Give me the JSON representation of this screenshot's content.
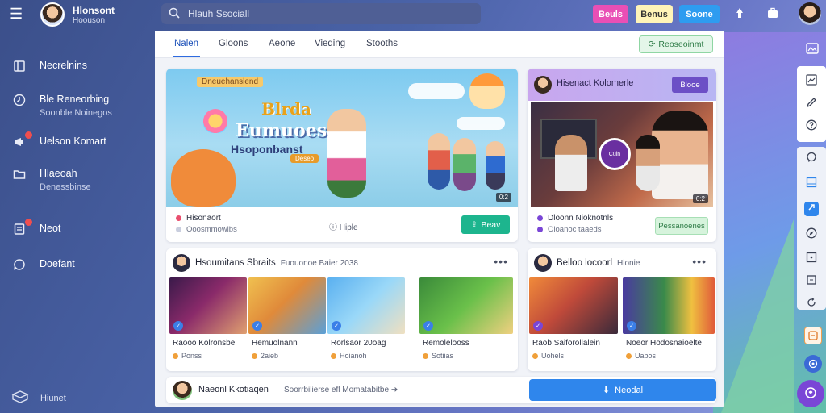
{
  "app": {
    "brand_title": "Hlonsont",
    "brand_subtitle": "Hoouson",
    "search_placeholder": "Hlauh Ssociall"
  },
  "top_buttons": [
    {
      "label": "Beuls"
    },
    {
      "label": "Benus"
    },
    {
      "label": "Soone"
    }
  ],
  "sidebar": {
    "items": [
      {
        "label": "Necrelnins",
        "sub": "",
        "icon": "book-icon"
      },
      {
        "label": "Ble Reneorbing",
        "sub": "Soonble Noinegos",
        "icon": "clock-icon"
      },
      {
        "label": "Uelson Komart",
        "sub": "",
        "icon": "megaphone-icon"
      },
      {
        "label": "Hlaeoah",
        "sub": "Denessbinse",
        "icon": "folder-icon"
      },
      {
        "label": "Neot",
        "sub": "",
        "icon": "document-icon"
      },
      {
        "label": "Doefant",
        "sub": "",
        "icon": "chat-icon"
      }
    ],
    "footer_label": "Hiunet"
  },
  "tabs": [
    {
      "label": "Nalen"
    },
    {
      "label": "Gloons"
    },
    {
      "label": "Aeone"
    },
    {
      "label": "Vieding"
    },
    {
      "label": "Stooths"
    }
  ],
  "tab_action": "Reoseoinmt",
  "hero": {
    "tag": "Dneuehanslend",
    "title_line1": "Blrda",
    "title_line2": "Eumuoes",
    "title_line3": "Hsoponbanst",
    "chip": "Deseo",
    "duration": "0:2",
    "meta_title": "Hisonaort",
    "meta_sub": "Ooosmmowlbs",
    "mid_label": "Hiple",
    "button": "Beav"
  },
  "featured": {
    "title": "Hisenact Kolomerle",
    "badge": "Blooe",
    "ring_text": "Cuin",
    "duration": "0:2",
    "meta_title": "Dloonn Nioknotnls",
    "meta_sub": "Oloanoc taaeds",
    "button": "Pessanoenes"
  },
  "section1": {
    "title": "Hsoumitans Sbraits",
    "subtitle": "Fuouonoe Baier 2038",
    "thumbs": [
      {
        "title": "Raooo Kolronsbe",
        "meta": "Ponss"
      },
      {
        "title": "Hemuolnann",
        "meta": "2aieb"
      },
      {
        "title": "Rorlsaor 20oag",
        "meta": "Hoianoh"
      },
      {
        "title": "Remolelooss",
        "meta": "Sotiias"
      }
    ]
  },
  "section2": {
    "title": "Belloo locoorl",
    "subtitle": "Hlonie",
    "thumbs": [
      {
        "title": "Raob Saiforollalein",
        "meta": "Uohels"
      },
      {
        "title": "Noeor Hodosnaioelte",
        "meta": "Uabos"
      }
    ]
  },
  "bottom": {
    "title": "Naeonl Kkotiaqen",
    "subtitle": "Soorrbilierse efl Momatabitbe",
    "button": "Neodal"
  },
  "colors": {
    "accent": "#2f86ec",
    "pink": "#e94fb5",
    "green": "#1db58e",
    "purple": "#7a46d6"
  }
}
